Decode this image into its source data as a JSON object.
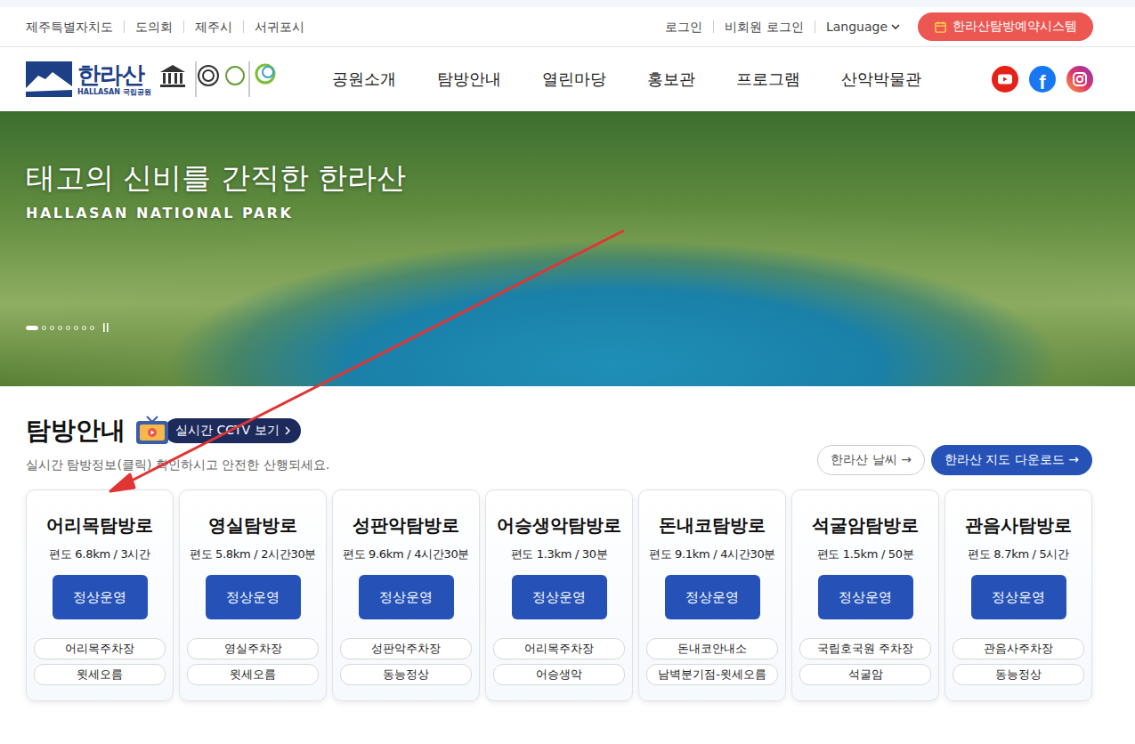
{
  "utility_links": [
    "제주특별자치도",
    "도의회",
    "제주시",
    "서귀포시"
  ],
  "account_links": [
    "로그인",
    "비회원 로그인"
  ],
  "language": "Language",
  "reservation_button": "한라산탐방예약시스템",
  "logo": {
    "title": "한라산",
    "subtitle": "HALLASAN 국립공원"
  },
  "nav": [
    "공원소개",
    "탐방안내",
    "열린마당",
    "홍보관",
    "프로그램",
    "산악박물관"
  ],
  "social": [
    {
      "kind": "youtube",
      "glyph": ""
    },
    {
      "kind": "facebook",
      "glyph": "f"
    },
    {
      "kind": "instagram",
      "glyph": ""
    }
  ],
  "hero": {
    "title": "태고의 신비를 간직한 한라산",
    "subtitle": "HALLASAN NATIONAL PARK",
    "slides": [
      {
        "selected": true
      },
      {
        "selected": false
      },
      {
        "selected": false
      },
      {
        "selected": false
      },
      {
        "selected": false
      },
      {
        "selected": false
      },
      {
        "selected": false
      },
      {
        "selected": false
      }
    ]
  },
  "section": {
    "title": "탐방안내",
    "cctv_button": "실시간 CCTV 보기",
    "description": "실시간 탐방정보(클릭) 확인하시고 안전한 산행되세요.",
    "weather_button": "한라산 날씨",
    "map_button": "한라산 지도 다운로드",
    "arrow": "→"
  },
  "trails": [
    {
      "name": "어리목탐방로",
      "info": "편도 6.8km / 3시간",
      "status": "정상운영",
      "points": [
        "어리목주차장",
        "윗세오름"
      ]
    },
    {
      "name": "영실탐방로",
      "info": "편도 5.8km / 2시간30분",
      "status": "정상운영",
      "points": [
        "영실주차장",
        "윗세오름"
      ]
    },
    {
      "name": "성판악탐방로",
      "info": "편도 9.6km / 4시간30분",
      "status": "정상운영",
      "points": [
        "성판악주차장",
        "동능정상"
      ]
    },
    {
      "name": "어승생악탐방로",
      "info": "편도 1.3km / 30분",
      "status": "정상운영",
      "points": [
        "어리목주차장",
        "어승생악"
      ]
    },
    {
      "name": "돈내코탐방로",
      "info": "편도 9.1km / 4시간30분",
      "status": "정상운영",
      "points": [
        "돈내코안내소",
        "남벽분기점-윗세오름"
      ]
    },
    {
      "name": "석굴암탐방로",
      "info": "편도 1.5km / 50분",
      "status": "정상운영",
      "points": [
        "국립호국원 주차장",
        "석굴암"
      ]
    },
    {
      "name": "관음사탐방로",
      "info": "편도 8.7km / 5시간",
      "status": "정상운영",
      "points": [
        "관음사주차장",
        "동능정상"
      ]
    }
  ]
}
